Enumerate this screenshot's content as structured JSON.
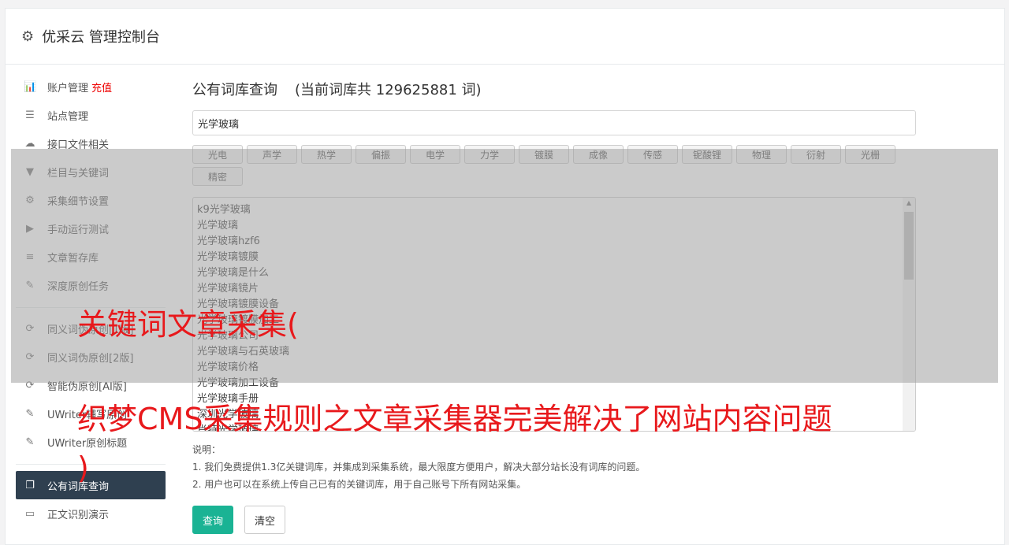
{
  "header": {
    "title": "优采云 管理控制台"
  },
  "sidebar": {
    "items": [
      {
        "label": "账户管理",
        "icon": "bar-chart-icon",
        "glyph": "📊",
        "extra": "充值"
      },
      {
        "label": "站点管理",
        "icon": "server-icon",
        "glyph": "☰"
      },
      {
        "label": "接口文件相关",
        "icon": "cloud-upload-icon",
        "glyph": "☁"
      },
      {
        "label": "栏目与关键词",
        "icon": "filter-icon",
        "glyph": "▼"
      },
      {
        "label": "采集细节设置",
        "icon": "cogs-icon",
        "glyph": "⚙"
      },
      {
        "label": "手动运行测试",
        "icon": "play-circle-icon",
        "glyph": "▶"
      },
      {
        "label": "文章暂存库",
        "icon": "database-icon",
        "glyph": "≡"
      },
      {
        "label": "深度原创任务",
        "icon": "edit-icon",
        "glyph": "✎"
      },
      {
        "label": "同义词伪原创[1版]",
        "icon": "refresh-icon",
        "glyph": "⟳"
      },
      {
        "label": "同义词伪原创[2版]",
        "icon": "refresh-icon",
        "glyph": "⟳"
      },
      {
        "label": "智能伪原创[AI版]",
        "icon": "refresh-icon",
        "glyph": "⟳"
      },
      {
        "label": "UWriter辅写原创",
        "icon": "edit-icon",
        "glyph": "✎"
      },
      {
        "label": "UWriter原创标题",
        "icon": "edit-icon",
        "glyph": "✎"
      },
      {
        "label": "公有词库查询",
        "icon": "book-icon",
        "glyph": "❐"
      },
      {
        "label": "正文识别演示",
        "icon": "desktop-icon",
        "glyph": "▭"
      }
    ]
  },
  "main": {
    "title": "公有词库查询",
    "count_text": "(当前词库共 129625881 词)",
    "search_value": "光学玻璃",
    "tags": [
      "光电",
      "声学",
      "热学",
      "偏振",
      "电学",
      "力学",
      "镀膜",
      "成像",
      "传感",
      "铌酸锂",
      "物理",
      "衍射",
      "光栅",
      "精密"
    ],
    "results": [
      "k9光学玻璃",
      "光学玻璃",
      "光学玻璃hzf6",
      "光学玻璃镀膜",
      "光学玻璃是什么",
      "光学玻璃镜片",
      "光学玻璃镀膜设备",
      "光学玻璃镀膜加工",
      "光学玻璃公司",
      "光学玻璃与石英玻璃",
      "光学玻璃价格",
      "光学玻璃加工设备",
      "光学玻璃手册",
      "深圳光学玻璃",
      "肖特光学玻璃"
    ],
    "notes_title": "说明：",
    "notes": [
      "1. 我们免费提供1.3亿关键词库，并集成到采集系统，最大限度方便用户，解决大部分站长没有词库的问题。",
      "2. 用户也可以在系统上传自己已有的关键词库，用于自己账号下所有网站采集。"
    ],
    "query_button": "查询",
    "clear_button": "清空"
  },
  "overlay": {
    "line1": "关键词文章采集(",
    "line2": "织梦CMS采集规则之文章采集器完美解决了网站内容问题",
    "line3": ")"
  }
}
